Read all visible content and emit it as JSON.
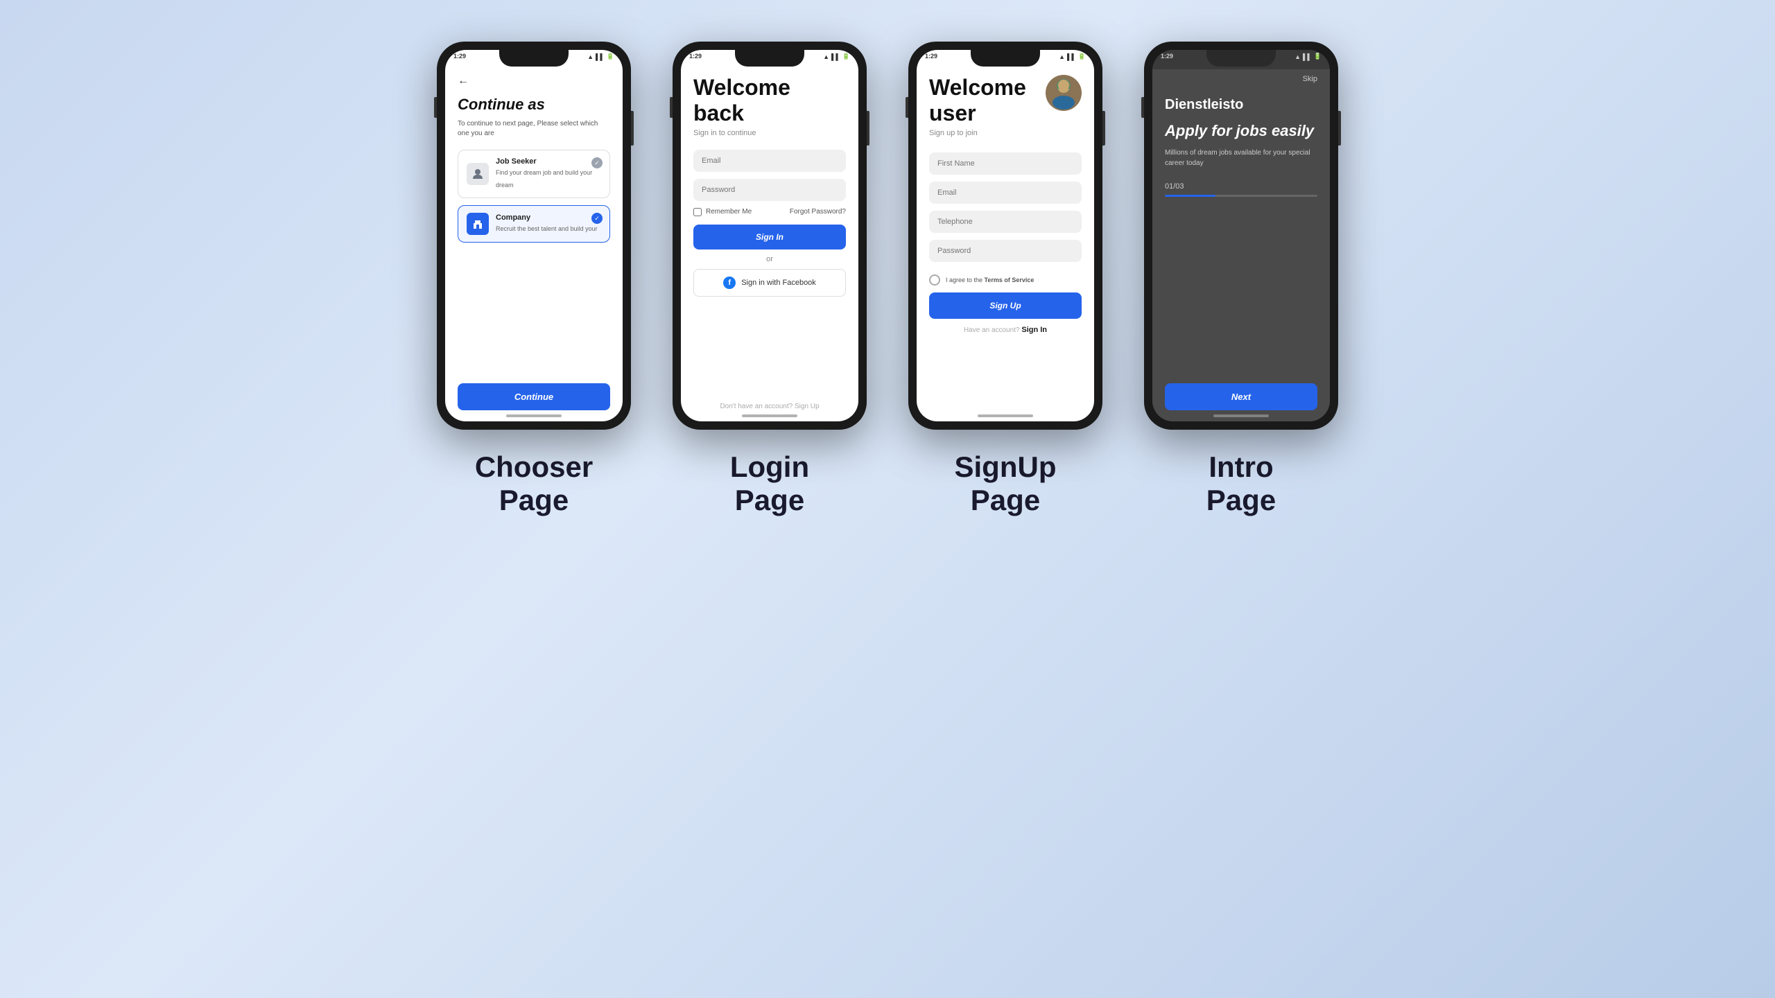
{
  "background": {
    "gradient_start": "#c8d8f0",
    "gradient_end": "#b8cce8"
  },
  "phones": {
    "chooser": {
      "status_time": "1:29",
      "back_arrow": "←",
      "title": "Continue as",
      "subtitle": "To continue to next page, Please select which one you are",
      "role_seeker": {
        "name": "Job Seeker",
        "desc": "Find your dream job and build your dream",
        "check": "✓"
      },
      "role_company": {
        "name": "Company",
        "desc": "Recruit the best talent and build your",
        "check": "✓"
      },
      "continue_btn": "Continue"
    },
    "login": {
      "status_time": "1:29",
      "title_line1": "Welcome",
      "title_line2": "back",
      "subtitle": "Sign in to continue",
      "email_placeholder": "Email",
      "password_placeholder": "Password",
      "remember_me": "Remember Me",
      "forgot_password": "Forgot Password?",
      "sign_in_btn": "Sign In",
      "or_text": "or",
      "facebook_btn": "Sign in with Facebook",
      "no_account": "Don't have an account?",
      "signup_link": "Sign Up"
    },
    "signup": {
      "status_time": "1:29",
      "title_line1": "Welcome",
      "title_line2": "user",
      "subtitle": "Sign up to join",
      "firstname_placeholder": "First Name",
      "email_placeholder": "Email",
      "telephone_placeholder": "Telephone",
      "password_placeholder": "Password",
      "terms_text": "I agree to the ",
      "terms_bold": "Terms of Service",
      "sign_up_btn": "Sign Up",
      "have_account": "Have an account?",
      "signin_link": "Sign In"
    },
    "intro": {
      "status_time": "1:29",
      "skip_label": "Skip",
      "brand": "Dienstleisto",
      "tagline": "Apply for jobs easily",
      "description": "Millions of dream jobs available for your special career today",
      "progress_label": "01/03",
      "progress_percent": 33,
      "next_btn": "Next"
    }
  },
  "page_labels": {
    "chooser": "Chooser\nPage",
    "login": "Login\nPage",
    "signup": "SignUp\nPage",
    "intro": "Intro\nPage"
  }
}
